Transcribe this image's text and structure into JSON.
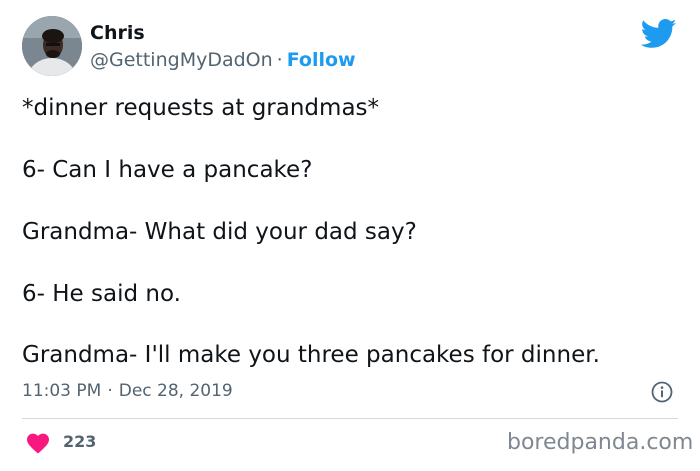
{
  "author": {
    "name": "Chris",
    "handle": "@GettingMyDadOn",
    "separator": "·",
    "follow_label": "Follow",
    "avatar_icon": "user-avatar-photo"
  },
  "tweet": {
    "lines": [
      "*dinner requests at grandmas*",
      "6- Can I have a pancake?",
      "Grandma- What did your dad say?",
      "6- He said no.",
      "Grandma- I'll make you three pancakes for dinner."
    ],
    "time": "11:03 PM",
    "separator": "·",
    "date": "Dec 28, 2019"
  },
  "engagement": {
    "likes": "223",
    "like_icon": "heart-icon",
    "like_color": "#f91880"
  },
  "brand": {
    "platform_icon": "twitter-bird-icon",
    "platform_color": "#1d9bf0",
    "info_icon": "info-icon"
  },
  "watermark": "boredpanda.com"
}
